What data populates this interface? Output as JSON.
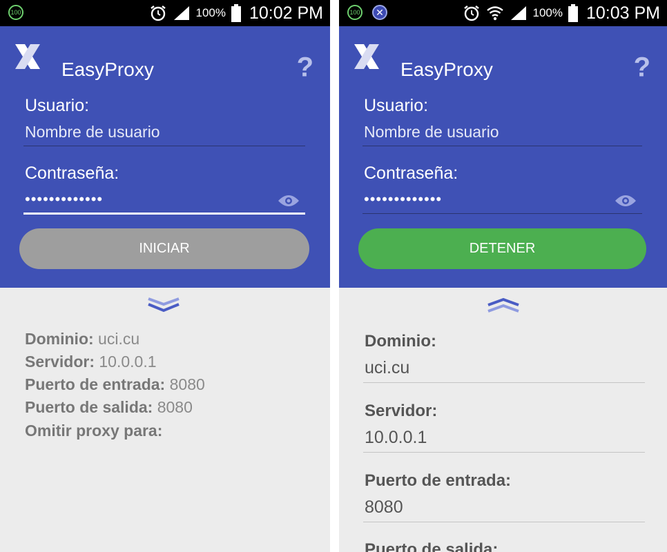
{
  "left": {
    "status": {
      "indicator": "100",
      "battery": "100%",
      "time": "10:02 PM"
    },
    "app_title": "EasyProxy",
    "help": "?",
    "user_label": "Usuario:",
    "user_value": "Nombre de usuario",
    "pass_label": "Contraseña:",
    "pass_value": "•••••••••••••",
    "button_label": "INICIAR",
    "details": [
      {
        "label": "Dominio:",
        "value": "uci.cu"
      },
      {
        "label": "Servidor:",
        "value": "10.0.0.1"
      },
      {
        "label": "Puerto de entrada:",
        "value": "8080"
      },
      {
        "label": "Puerto de salida:",
        "value": "8080"
      },
      {
        "label": "Omitir proxy para:",
        "value": ""
      }
    ]
  },
  "right": {
    "status": {
      "indicator": "100",
      "battery": "100%",
      "time": "10:03 PM"
    },
    "app_title": "EasyProxy",
    "help": "?",
    "user_label": "Usuario:",
    "user_value": "Nombre de usuario",
    "pass_label": "Contraseña:",
    "pass_value": "•••••••••••••",
    "button_label": "DETENER",
    "fields": [
      {
        "label": "Dominio:",
        "value": "uci.cu"
      },
      {
        "label": "Servidor:",
        "value": "10.0.0.1"
      },
      {
        "label": "Puerto de entrada:",
        "value": "8080"
      },
      {
        "label": "Puerto de salida:",
        "value": ""
      }
    ]
  },
  "colors": {
    "primary": "#3f51b5",
    "start_button": "#9e9e9e",
    "stop_button": "#4caf50",
    "panel_bg": "#ececec"
  },
  "icons": [
    "alarm-icon",
    "signal-icon",
    "battery-icon",
    "wifi-icon",
    "app-logo-x-icon",
    "help-icon",
    "eye-icon",
    "chevron-down-icon",
    "chevron-up-icon",
    "notification-x-icon"
  ]
}
